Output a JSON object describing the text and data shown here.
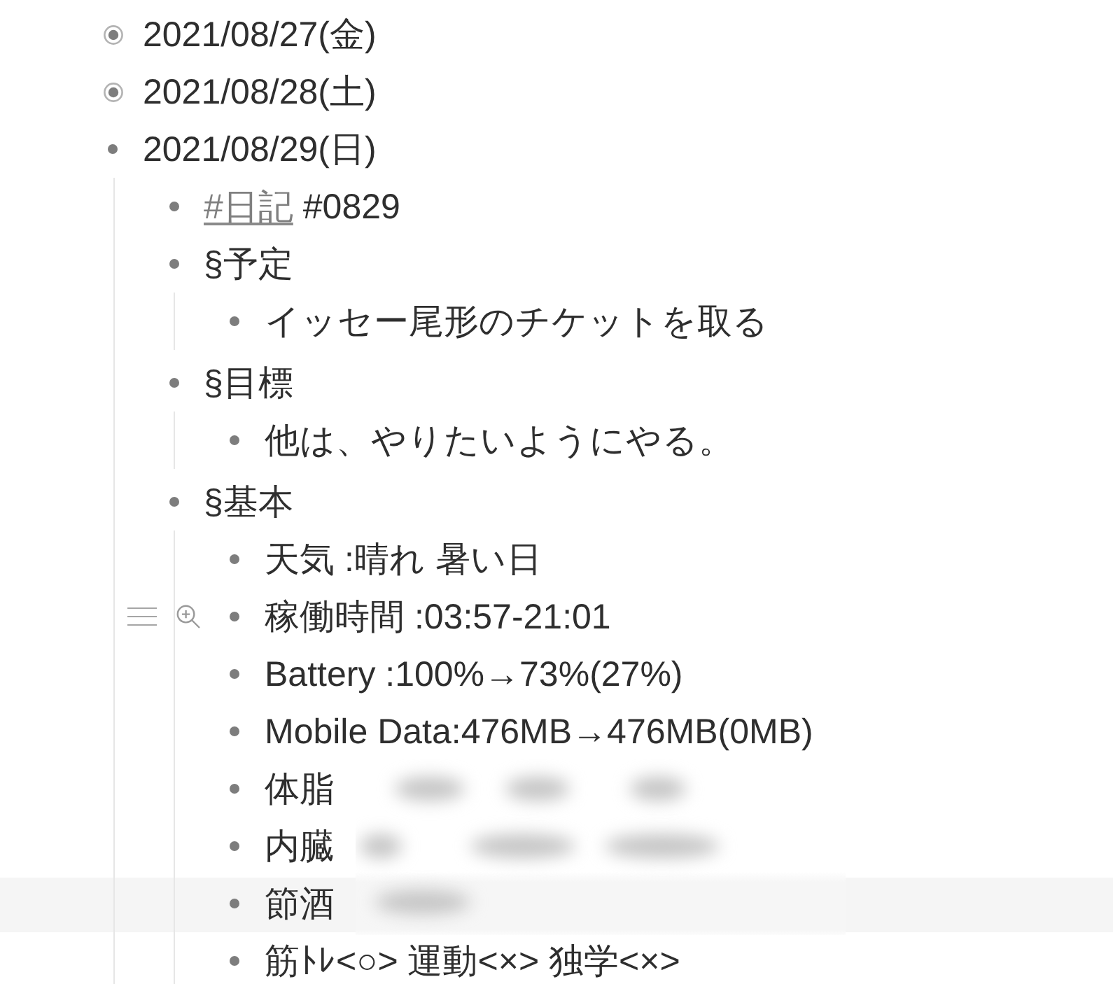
{
  "outline": {
    "items": [
      {
        "text": "2021/08/27(金)",
        "collapsed": true
      },
      {
        "text": "2021/08/28(土)",
        "collapsed": true
      },
      {
        "text": "2021/08/29(日)",
        "collapsed": false,
        "children": [
          {
            "segments": [
              {
                "kind": "tag",
                "text": "#日記"
              },
              {
                "kind": "text",
                "text": "#0829"
              }
            ]
          },
          {
            "text": "§予定",
            "children": [
              {
                "text": "イッセー尾形のチケットを取る"
              }
            ]
          },
          {
            "text": "§目標",
            "children": [
              {
                "text": "他は、やりたいようにやる。"
              }
            ]
          },
          {
            "text": "§基本",
            "children": [
              {
                "text": "天気 :晴れ 暑い日",
                "hovered": false,
                "highlighted": false
              },
              {
                "text": "稼働時間 :03:57-21:01",
                "hovered": true,
                "highlighted": false
              },
              {
                "text": "Battery :100%→73%(27%)",
                "hovered": false,
                "highlighted": false
              },
              {
                "text": "Mobile Data:476MB→476MB(0MB)",
                "hovered": false,
                "highlighted": false
              },
              {
                "text": "体脂",
                "hovered": false,
                "highlighted": false
              },
              {
                "text": "内臓",
                "hovered": false,
                "highlighted": false
              },
              {
                "text": "節酒",
                "hovered": false,
                "highlighted": true
              },
              {
                "text": "筋ﾄﾚ<○> 運動<×> 独学<×>",
                "hovered": false,
                "highlighted": false
              }
            ]
          }
        ]
      }
    ]
  }
}
